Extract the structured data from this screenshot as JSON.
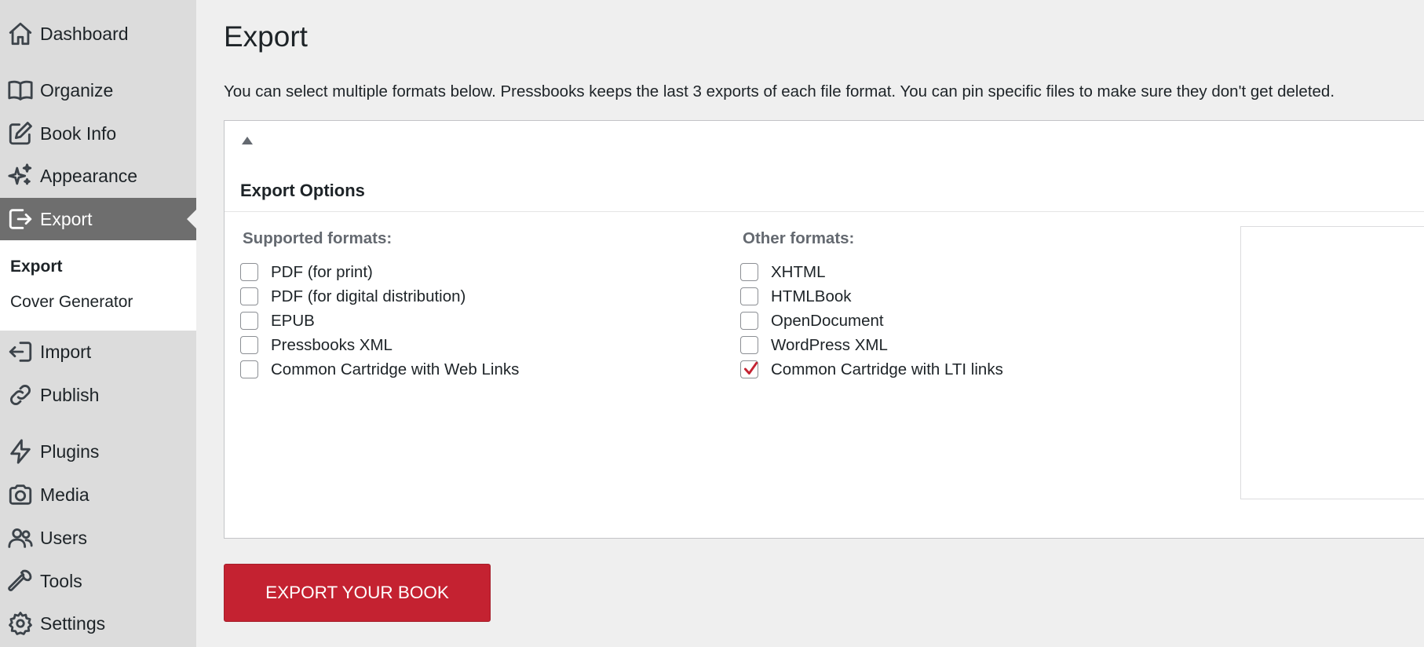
{
  "sidebar": {
    "items": [
      {
        "label": "Dashboard",
        "icon": "home-icon"
      },
      {
        "label": "Organize",
        "icon": "book-open-icon"
      },
      {
        "label": "Book Info",
        "icon": "edit-icon"
      },
      {
        "label": "Appearance",
        "icon": "sparkles-icon"
      },
      {
        "label": "Export",
        "icon": "export-icon",
        "active": true
      },
      {
        "label": "Import",
        "icon": "import-icon"
      },
      {
        "label": "Publish",
        "icon": "link-icon"
      },
      {
        "label": "Plugins",
        "icon": "bolt-icon"
      },
      {
        "label": "Media",
        "icon": "camera-icon"
      },
      {
        "label": "Users",
        "icon": "users-icon"
      },
      {
        "label": "Tools",
        "icon": "wrench-icon"
      },
      {
        "label": "Settings",
        "icon": "gear-icon"
      }
    ],
    "submenu": [
      {
        "label": "Export",
        "current": true
      },
      {
        "label": "Cover Generator"
      }
    ]
  },
  "main": {
    "title": "Export",
    "intro": "You can select multiple formats below. Pressbooks keeps the last 3 exports of each file format. You can pin specific files to make sure they don't get deleted.",
    "panel": {
      "heading": "Export Options",
      "supported_heading": "Supported formats:",
      "other_heading": "Other formats:",
      "supported_formats": [
        {
          "label": "PDF (for print)",
          "checked": false
        },
        {
          "label": "PDF (for digital distribution)",
          "checked": false
        },
        {
          "label": "EPUB",
          "checked": false
        },
        {
          "label": "Pressbooks XML",
          "checked": false
        },
        {
          "label": "Common Cartridge with Web Links",
          "checked": false
        }
      ],
      "other_formats": [
        {
          "label": "XHTML",
          "checked": false
        },
        {
          "label": "HTMLBook",
          "checked": false
        },
        {
          "label": "OpenDocument",
          "checked": false
        },
        {
          "label": "WordPress XML",
          "checked": false
        },
        {
          "label": "Common Cartridge with LTI links",
          "checked": true
        }
      ]
    },
    "export_button": "EXPORT YOUR BOOK"
  },
  "colors": {
    "accent": "#c42231",
    "sidebar_bg": "#dcdcdc",
    "active_bg": "#6e6e6e",
    "check_mark": "#c42231"
  }
}
